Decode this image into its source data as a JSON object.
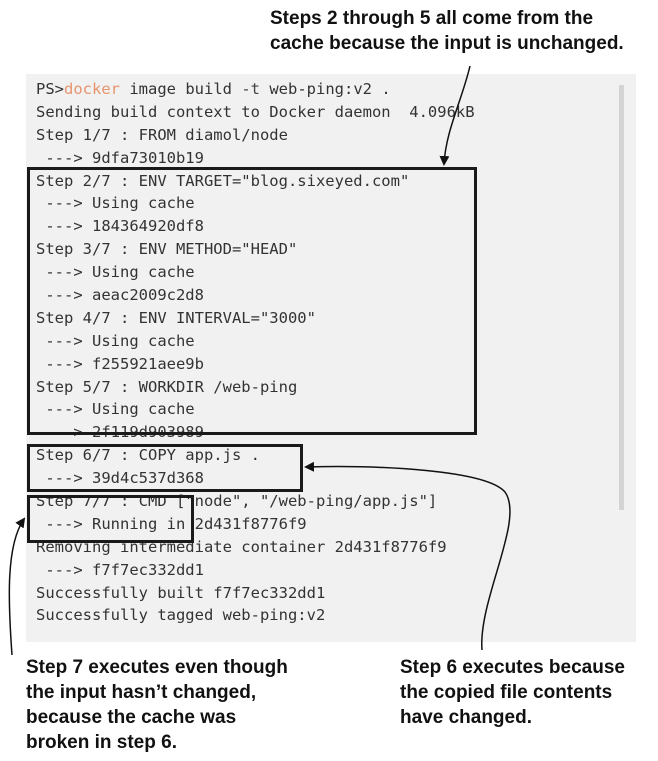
{
  "annotations": {
    "top": "Steps 2 through 5 all come from the\ncache because the input is unchanged.",
    "bottom_left": "Step 7 executes even though\nthe input hasn’t changed,\nbecause the cache was\nbroken in step 6.",
    "bottom_right": "Step 6 executes because\nthe copied file contents\nhave changed."
  },
  "terminal": {
    "prompt": "PS>",
    "command": "docker",
    "command_args_1": " image build ",
    "command_flag": "-t",
    "command_args_2": " web-ping:v2 .",
    "lines": [
      "Sending build context to Docker daemon  4.096kB",
      "Step 1/7 : FROM diamol/node",
      " ---> 9dfa73010b19",
      "Step 2/7 : ENV TARGET=\"blog.sixeyed.com\"",
      " ---> Using cache",
      " ---> 184364920df8",
      "Step 3/7 : ENV METHOD=\"HEAD\"",
      " ---> Using cache",
      " ---> aeac2009c2d8",
      "Step 4/7 : ENV INTERVAL=\"3000\"",
      " ---> Using cache",
      " ---> f255921aee9b",
      "Step 5/7 : WORKDIR /web-ping",
      " ---> Using cache",
      " ---> 2f119d903989",
      "Step 6/7 : COPY app.js .",
      " ---> 39d4c537d368",
      "Step 7/7 : CMD [\"node\", \"/web-ping/app.js\"]",
      " ---> Running in 2d431f8776f9",
      "Removing intermediate container 2d431f8776f9",
      " ---> f7f7ec332dd1",
      "Successfully built f7f7ec332dd1",
      "Successfully tagged web-ping:v2"
    ]
  },
  "colors": {
    "docker_keyword": "#e8946d",
    "terminal_bg": "#f1f1f1",
    "box_border": "#1a1a1a"
  }
}
